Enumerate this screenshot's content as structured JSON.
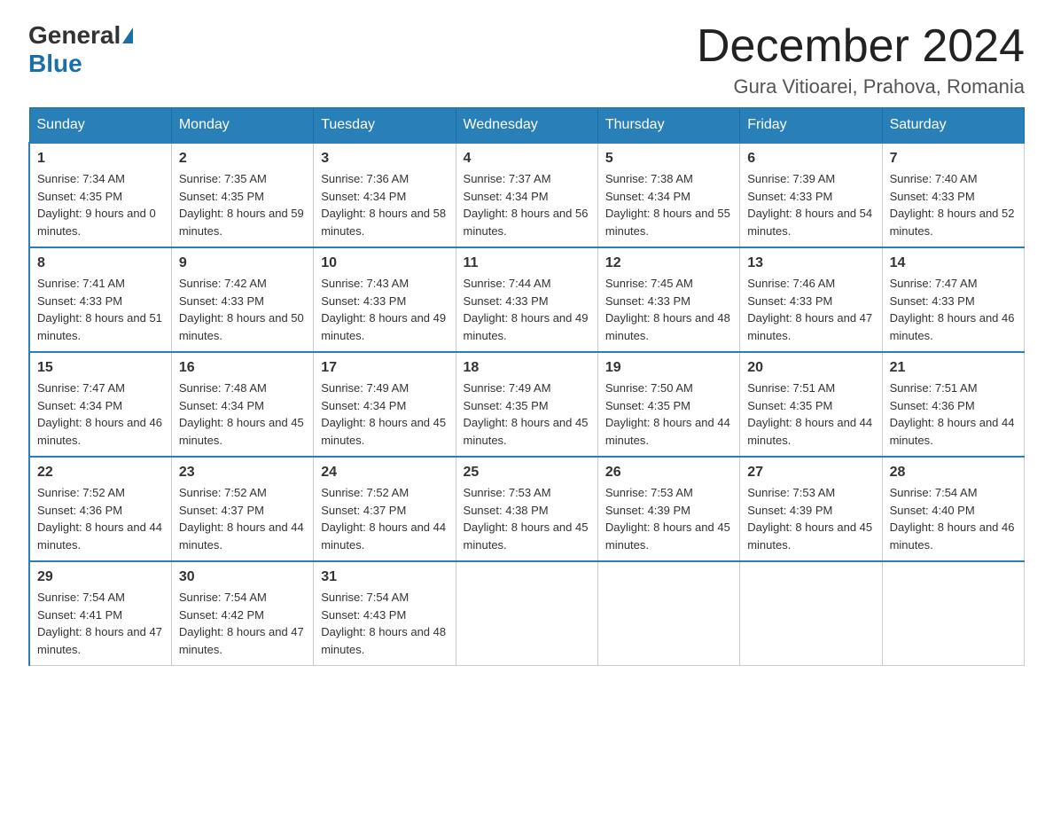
{
  "header": {
    "logo_general": "General",
    "logo_blue": "Blue",
    "month_title": "December 2024",
    "location": "Gura Vitioarei, Prahova, Romania"
  },
  "weekdays": [
    "Sunday",
    "Monday",
    "Tuesday",
    "Wednesday",
    "Thursday",
    "Friday",
    "Saturday"
  ],
  "weeks": [
    [
      {
        "day": "1",
        "sunrise": "7:34 AM",
        "sunset": "4:35 PM",
        "daylight": "9 hours and 0 minutes."
      },
      {
        "day": "2",
        "sunrise": "7:35 AM",
        "sunset": "4:35 PM",
        "daylight": "8 hours and 59 minutes."
      },
      {
        "day": "3",
        "sunrise": "7:36 AM",
        "sunset": "4:34 PM",
        "daylight": "8 hours and 58 minutes."
      },
      {
        "day": "4",
        "sunrise": "7:37 AM",
        "sunset": "4:34 PM",
        "daylight": "8 hours and 56 minutes."
      },
      {
        "day": "5",
        "sunrise": "7:38 AM",
        "sunset": "4:34 PM",
        "daylight": "8 hours and 55 minutes."
      },
      {
        "day": "6",
        "sunrise": "7:39 AM",
        "sunset": "4:33 PM",
        "daylight": "8 hours and 54 minutes."
      },
      {
        "day": "7",
        "sunrise": "7:40 AM",
        "sunset": "4:33 PM",
        "daylight": "8 hours and 52 minutes."
      }
    ],
    [
      {
        "day": "8",
        "sunrise": "7:41 AM",
        "sunset": "4:33 PM",
        "daylight": "8 hours and 51 minutes."
      },
      {
        "day": "9",
        "sunrise": "7:42 AM",
        "sunset": "4:33 PM",
        "daylight": "8 hours and 50 minutes."
      },
      {
        "day": "10",
        "sunrise": "7:43 AM",
        "sunset": "4:33 PM",
        "daylight": "8 hours and 49 minutes."
      },
      {
        "day": "11",
        "sunrise": "7:44 AM",
        "sunset": "4:33 PM",
        "daylight": "8 hours and 49 minutes."
      },
      {
        "day": "12",
        "sunrise": "7:45 AM",
        "sunset": "4:33 PM",
        "daylight": "8 hours and 48 minutes."
      },
      {
        "day": "13",
        "sunrise": "7:46 AM",
        "sunset": "4:33 PM",
        "daylight": "8 hours and 47 minutes."
      },
      {
        "day": "14",
        "sunrise": "7:47 AM",
        "sunset": "4:33 PM",
        "daylight": "8 hours and 46 minutes."
      }
    ],
    [
      {
        "day": "15",
        "sunrise": "7:47 AM",
        "sunset": "4:34 PM",
        "daylight": "8 hours and 46 minutes."
      },
      {
        "day": "16",
        "sunrise": "7:48 AM",
        "sunset": "4:34 PM",
        "daylight": "8 hours and 45 minutes."
      },
      {
        "day": "17",
        "sunrise": "7:49 AM",
        "sunset": "4:34 PM",
        "daylight": "8 hours and 45 minutes."
      },
      {
        "day": "18",
        "sunrise": "7:49 AM",
        "sunset": "4:35 PM",
        "daylight": "8 hours and 45 minutes."
      },
      {
        "day": "19",
        "sunrise": "7:50 AM",
        "sunset": "4:35 PM",
        "daylight": "8 hours and 44 minutes."
      },
      {
        "day": "20",
        "sunrise": "7:51 AM",
        "sunset": "4:35 PM",
        "daylight": "8 hours and 44 minutes."
      },
      {
        "day": "21",
        "sunrise": "7:51 AM",
        "sunset": "4:36 PM",
        "daylight": "8 hours and 44 minutes."
      }
    ],
    [
      {
        "day": "22",
        "sunrise": "7:52 AM",
        "sunset": "4:36 PM",
        "daylight": "8 hours and 44 minutes."
      },
      {
        "day": "23",
        "sunrise": "7:52 AM",
        "sunset": "4:37 PM",
        "daylight": "8 hours and 44 minutes."
      },
      {
        "day": "24",
        "sunrise": "7:52 AM",
        "sunset": "4:37 PM",
        "daylight": "8 hours and 44 minutes."
      },
      {
        "day": "25",
        "sunrise": "7:53 AM",
        "sunset": "4:38 PM",
        "daylight": "8 hours and 45 minutes."
      },
      {
        "day": "26",
        "sunrise": "7:53 AM",
        "sunset": "4:39 PM",
        "daylight": "8 hours and 45 minutes."
      },
      {
        "day": "27",
        "sunrise": "7:53 AM",
        "sunset": "4:39 PM",
        "daylight": "8 hours and 45 minutes."
      },
      {
        "day": "28",
        "sunrise": "7:54 AM",
        "sunset": "4:40 PM",
        "daylight": "8 hours and 46 minutes."
      }
    ],
    [
      {
        "day": "29",
        "sunrise": "7:54 AM",
        "sunset": "4:41 PM",
        "daylight": "8 hours and 47 minutes."
      },
      {
        "day": "30",
        "sunrise": "7:54 AM",
        "sunset": "4:42 PM",
        "daylight": "8 hours and 47 minutes."
      },
      {
        "day": "31",
        "sunrise": "7:54 AM",
        "sunset": "4:43 PM",
        "daylight": "8 hours and 48 minutes."
      },
      null,
      null,
      null,
      null
    ]
  ]
}
